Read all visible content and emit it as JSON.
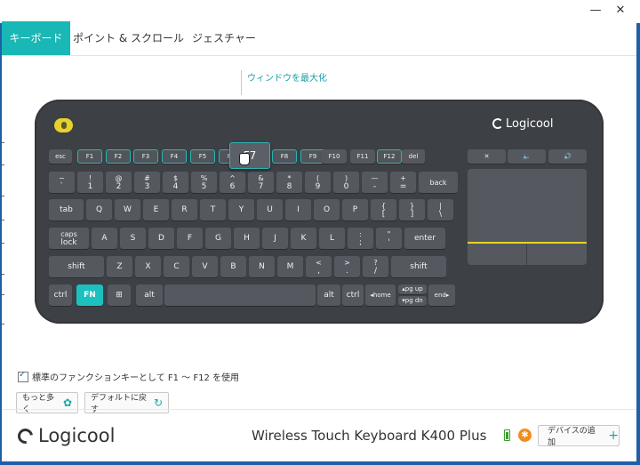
{
  "window": {
    "minimize": "—",
    "close": "✕"
  },
  "tabs": [
    {
      "label": "キーボード",
      "active": true
    },
    {
      "label": "ポイント & スクロール",
      "active": false
    },
    {
      "label": "ジェスチャー",
      "active": false
    }
  ],
  "callout": "ウィンドウを最大化",
  "keyboard": {
    "brand": "Logicool",
    "hovered_key": "F7",
    "row_fn": [
      "esc",
      "F1",
      "F2",
      "F3",
      "F4",
      "F5",
      "F6",
      "F7",
      "F8",
      "F9",
      "F10",
      "F11",
      "F12",
      "del"
    ],
    "row1": [
      [
        "~",
        "`"
      ],
      [
        "!",
        "1"
      ],
      [
        "@",
        "2"
      ],
      [
        "#",
        "3"
      ],
      [
        "$",
        "4"
      ],
      [
        "%",
        "5"
      ],
      [
        "^",
        "6"
      ],
      [
        "&",
        "7"
      ],
      [
        "*",
        "8"
      ],
      [
        "(",
        "9"
      ],
      [
        ")",
        "0"
      ],
      [
        "—",
        "-"
      ],
      [
        "+",
        "="
      ],
      [
        "back",
        ""
      ]
    ],
    "row2": [
      "tab",
      "Q",
      "W",
      "E",
      "R",
      "T",
      "Y",
      "U",
      "I",
      "O",
      "P",
      [
        "{",
        "["
      ],
      [
        "}",
        "]"
      ],
      [
        "|",
        "\\"
      ]
    ],
    "row3": [
      [
        "caps",
        "lock"
      ],
      "A",
      "S",
      "D",
      "F",
      "G",
      "H",
      "J",
      "K",
      "L",
      [
        ":",
        ";"
      ],
      [
        "\"",
        "'"
      ],
      "enter"
    ],
    "row4": [
      "shift",
      "Z",
      "X",
      "C",
      "V",
      "B",
      "N",
      "M",
      [
        "<",
        ","
      ],
      [
        ">",
        "."
      ],
      [
        "?",
        "/"
      ],
      "shift"
    ],
    "row5": [
      "ctrl",
      "FN",
      "⊞",
      "alt",
      "",
      "alt",
      "ctrl",
      "◂home",
      "▴pg up",
      "▾pg dn",
      "end▸"
    ],
    "media": [
      "✕",
      "🔈",
      "🔊"
    ]
  },
  "checkbox_label": "標準のファンクションキーとして F1 ～ F12 を使用",
  "checkbox_checked": true,
  "more_button": "もっと多く",
  "reset_button": "デフォルトに戻す",
  "footer": {
    "logo": "Logicool",
    "device_name": "Wireless Touch Keyboard K400 Plus",
    "add_device": "デバイスの追加"
  },
  "colors": {
    "accent": "#19b7b5",
    "keyboard": "#3d4045",
    "touch_yellow": "#e6d22c"
  }
}
